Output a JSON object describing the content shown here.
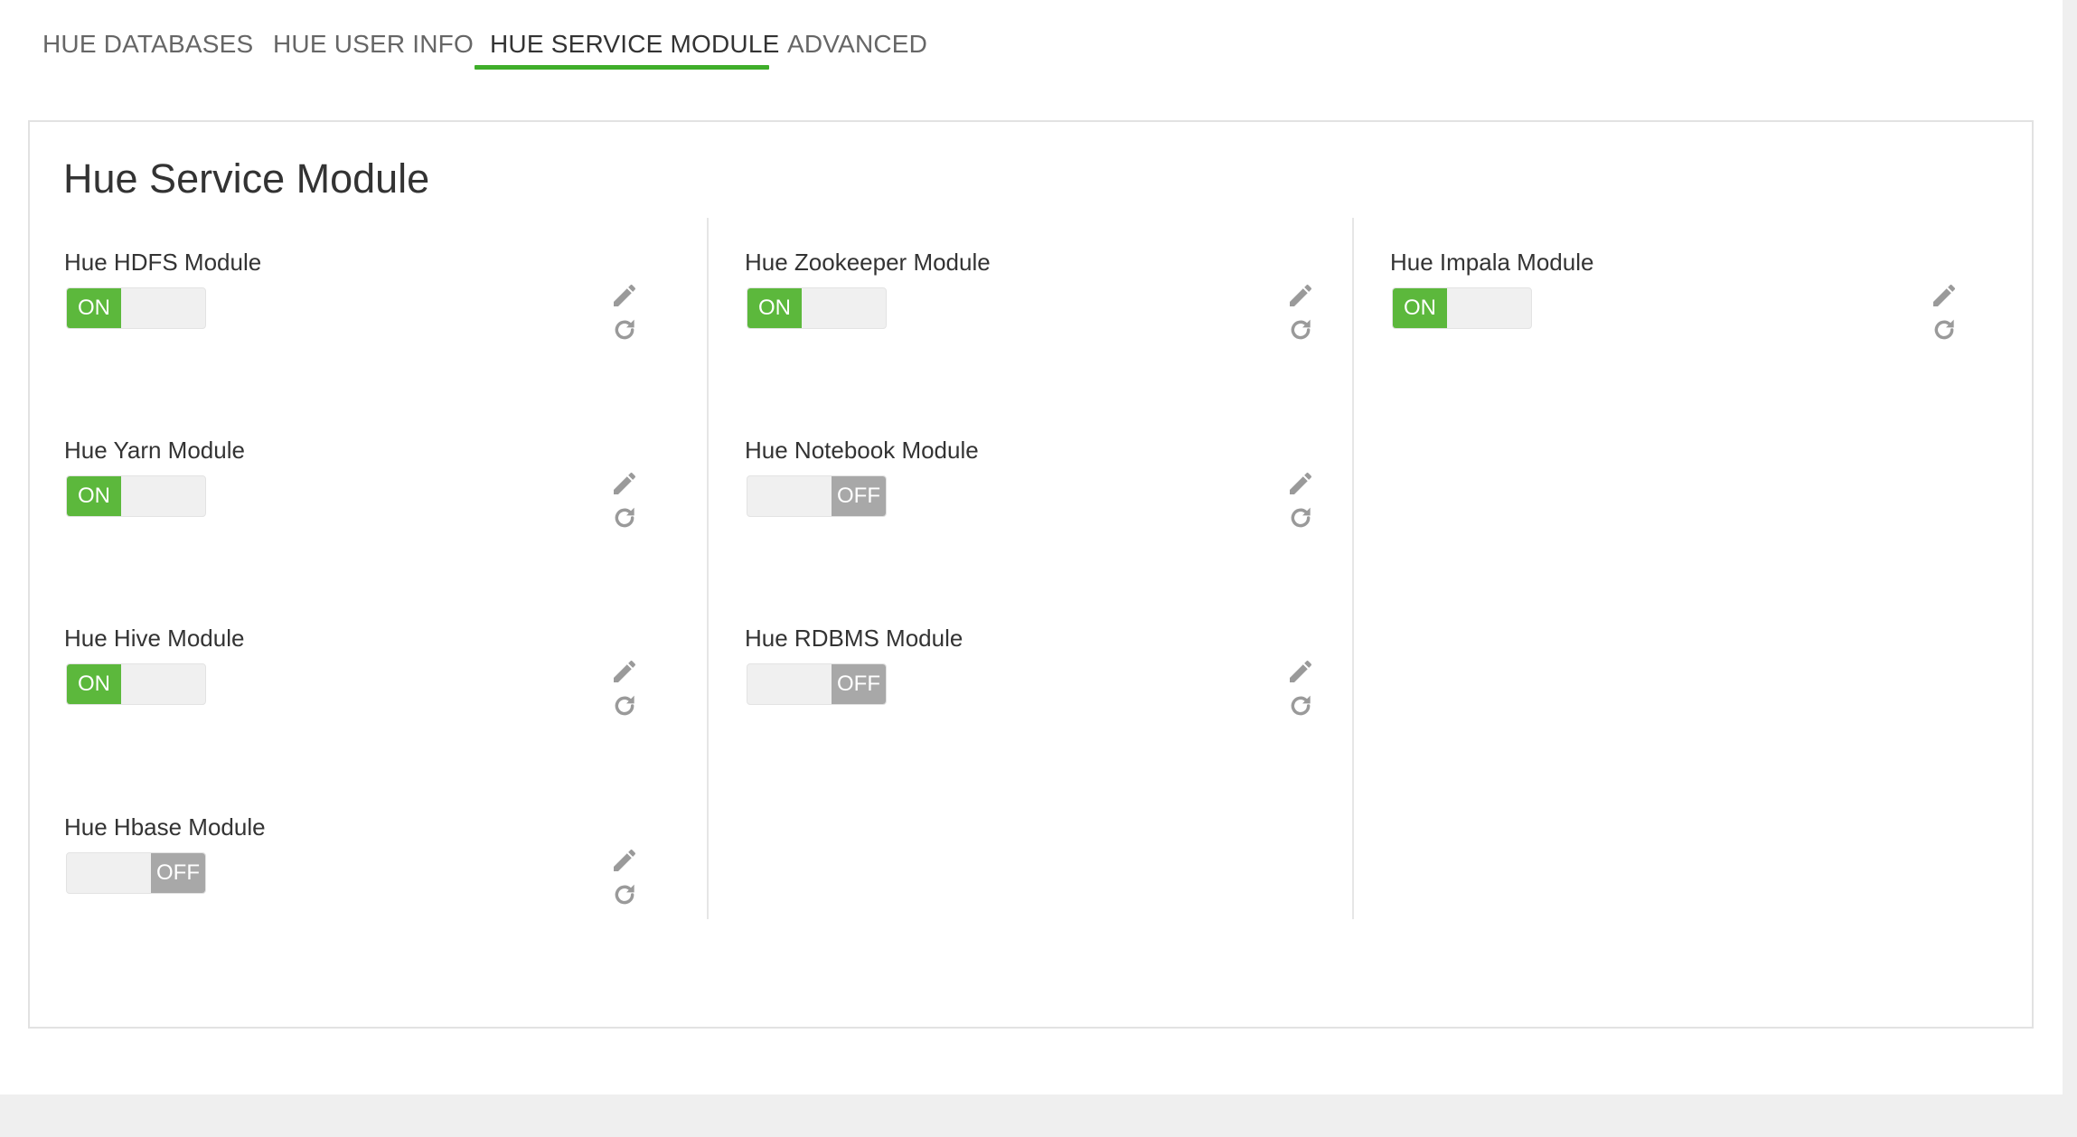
{
  "tabs": [
    {
      "label": "HUE DATABASES",
      "active": false
    },
    {
      "label": "HUE USER INFO",
      "active": false
    },
    {
      "label": "HUE SERVICE MODULE",
      "active": true
    },
    {
      "label": "ADVANCED",
      "active": false
    }
  ],
  "panel": {
    "title": "Hue Service Module"
  },
  "modules": {
    "hdfs": {
      "label": "Hue HDFS Module",
      "state": "ON"
    },
    "yarn": {
      "label": "Hue Yarn Module",
      "state": "ON"
    },
    "hive": {
      "label": "Hue Hive Module",
      "state": "ON"
    },
    "hbase": {
      "label": "Hue Hbase Module",
      "state": "OFF"
    },
    "zookeeper": {
      "label": "Hue Zookeeper Module",
      "state": "ON"
    },
    "notebook": {
      "label": "Hue Notebook Module",
      "state": "OFF"
    },
    "rdbms": {
      "label": "Hue RDBMS Module",
      "state": "OFF"
    },
    "impala": {
      "label": "Hue Impala Module",
      "state": "ON"
    }
  },
  "icons": {
    "edit": "pencil-icon",
    "undo": "undo-icon"
  },
  "colors": {
    "accent": "#3fae2a",
    "toggle_on": "#5cb83c",
    "toggle_off": "#a8a8a8",
    "icon": "#9a9a9a"
  }
}
